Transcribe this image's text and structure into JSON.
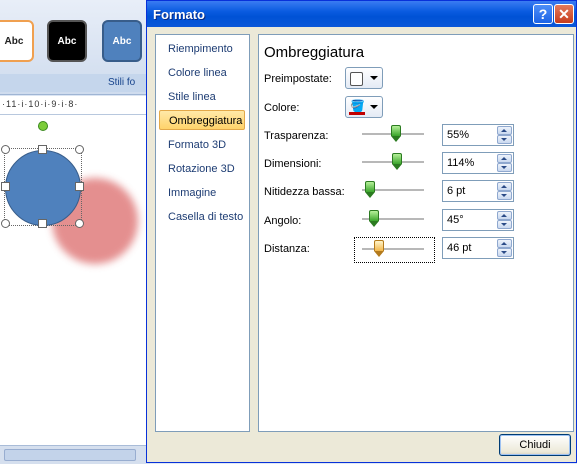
{
  "background": {
    "styles": [
      "Abc",
      "Abc",
      "Abc"
    ],
    "ribbon_group_label": "Stili fo",
    "ruler_text": "·11·i·10·i·9·i·8·"
  },
  "dialog": {
    "title": "Formato",
    "help_glyph": "?",
    "close_glyph": "✕",
    "nav": [
      "Riempimento",
      "Colore linea",
      "Stile linea",
      "Ombreggiatura",
      "Formato 3D",
      "Rotazione 3D",
      "Immagine",
      "Casella di testo"
    ],
    "selected_nav": "Ombreggiatura",
    "panel": {
      "heading": "Ombreggiatura",
      "preset_label": "Preimpostate:",
      "color_label": "Colore:",
      "color_value": "#c00000",
      "settings": [
        {
          "label": "Trasparenza:",
          "value": "55%",
          "level_pct": 55
        },
        {
          "label": "Dimensioni:",
          "value": "114%",
          "level_pct": 57
        },
        {
          "label": "Nitidezza bassa:",
          "value": "6 pt",
          "level_pct": 6
        },
        {
          "label": "Angolo:",
          "value": "45°",
          "level_pct": 13
        },
        {
          "label": "Distanza:",
          "value": "46 pt",
          "level_pct": 23
        }
      ]
    },
    "close_button": "Chiudi"
  }
}
